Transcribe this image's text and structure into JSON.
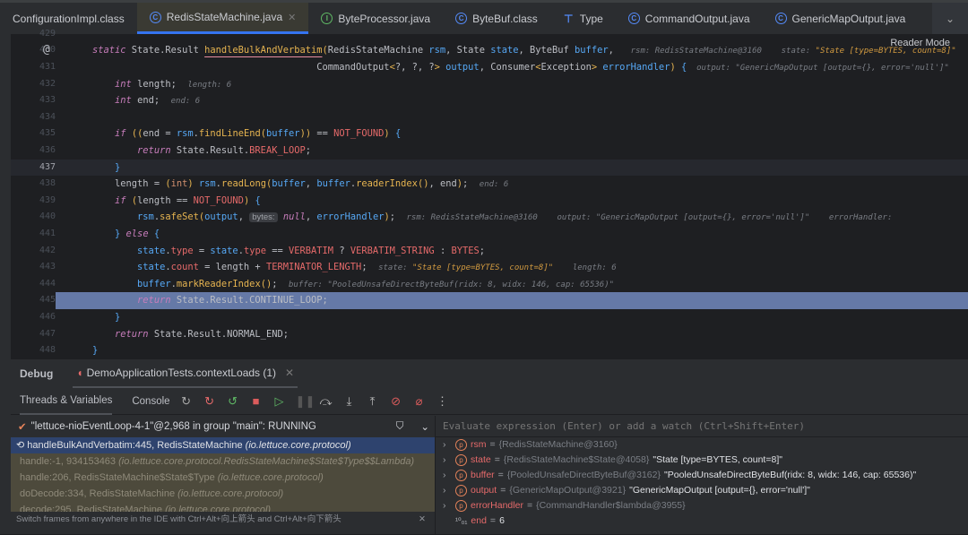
{
  "tabs": [
    {
      "label": "ConfigurationImpl.class",
      "icon": "none"
    },
    {
      "label": "RedisStateMachine.java",
      "icon": "class-icon",
      "active": true
    },
    {
      "label": "ByteProcessor.java",
      "icon": "interface-icon"
    },
    {
      "label": "ByteBuf.class",
      "icon": "class-icon"
    },
    {
      "label": "Type",
      "icon": "type-icon"
    },
    {
      "label": "CommandOutput.java",
      "icon": "class-icon"
    },
    {
      "label": "GenericMapOutput.java",
      "icon": "class-icon"
    }
  ],
  "editor": {
    "reader_mode": "Reader Mode",
    "current_line": 437,
    "execution_line": 445,
    "lines": [
      {
        "n": 429,
        "t": []
      },
      {
        "n": 430,
        "g": "@",
        "t": [
          [
            "static ",
            "kw"
          ],
          [
            "State.Result ",
            "pl"
          ],
          [
            "handleBulkAndVerbatim",
            "fnname"
          ],
          [
            "(",
            "gen"
          ],
          [
            "RedisStateMachine ",
            "pl"
          ],
          [
            "rsm",
            "var"
          ],
          [
            ", State ",
            "pl"
          ],
          [
            "state",
            "var"
          ],
          [
            ", ByteBuf ",
            "pl"
          ],
          [
            "buffer",
            "var"
          ],
          [
            ",   ",
            "pl"
          ],
          [
            "rsm: RedisStateMachine@3160    ",
            "hint"
          ],
          [
            "state: ",
            "hint"
          ],
          [
            "\"State [type=BYTES, count=8]\"",
            "hstr"
          ]
        ]
      },
      {
        "n": 431,
        "t": [
          [
            "                                        CommandOutput",
            "pl"
          ],
          [
            "<",
            "gen"
          ],
          [
            "?, ?, ?",
            "pl"
          ],
          [
            ">",
            "gen"
          ],
          [
            " ",
            "pl"
          ],
          [
            "output",
            "var"
          ],
          [
            ", Consumer",
            "pl"
          ],
          [
            "<",
            "gen"
          ],
          [
            "Exception",
            "pl"
          ],
          [
            ">",
            "gen"
          ],
          [
            " ",
            "pl"
          ],
          [
            "errorHandler",
            "var"
          ],
          [
            ") ",
            "gen"
          ],
          [
            "{",
            "brace"
          ],
          [
            "  output: \"GenericMapOutput [output={}, error='null']\"",
            "hint"
          ]
        ]
      },
      {
        "n": 432,
        "t": [
          [
            "    ",
            "pl"
          ],
          [
            "int ",
            "kw"
          ],
          [
            "length;  ",
            "pl"
          ],
          [
            "length: 6",
            "hint"
          ]
        ]
      },
      {
        "n": 433,
        "t": [
          [
            "    ",
            "pl"
          ],
          [
            "int ",
            "kw"
          ],
          [
            "end;  ",
            "pl"
          ],
          [
            "end: 6",
            "hint"
          ]
        ]
      },
      {
        "n": 434,
        "t": []
      },
      {
        "n": 435,
        "t": [
          [
            "    ",
            "pl"
          ],
          [
            "if ",
            "kw"
          ],
          [
            "((",
            "gen"
          ],
          [
            "end = ",
            "pl"
          ],
          [
            "rsm",
            "var"
          ],
          [
            ".",
            "pl"
          ],
          [
            "findLineEnd",
            "fn"
          ],
          [
            "(",
            "gen"
          ],
          [
            "buffer",
            "var"
          ],
          [
            "))",
            "gen"
          ],
          [
            " == ",
            "pl"
          ],
          [
            "NOT_FOUND",
            "const"
          ],
          [
            ") ",
            "gen"
          ],
          [
            "{",
            "brace"
          ]
        ]
      },
      {
        "n": 436,
        "t": [
          [
            "        ",
            "pl"
          ],
          [
            "return ",
            "kw"
          ],
          [
            "State.Result.",
            "pl"
          ],
          [
            "BREAK_LOOP",
            "const"
          ],
          [
            ";",
            "pl"
          ]
        ]
      },
      {
        "n": 437,
        "t": [
          [
            "    ",
            "pl"
          ],
          [
            "}",
            "brace"
          ]
        ]
      },
      {
        "n": 438,
        "t": [
          [
            "    length = ",
            "pl"
          ],
          [
            "(",
            "gen"
          ],
          [
            "int",
            "kwn"
          ],
          [
            ") ",
            "gen"
          ],
          [
            "rsm",
            "var"
          ],
          [
            ".",
            "pl"
          ],
          [
            "readLong",
            "fn"
          ],
          [
            "(",
            "gen"
          ],
          [
            "buffer",
            "var"
          ],
          [
            ", ",
            "pl"
          ],
          [
            "buffer",
            "var"
          ],
          [
            ".",
            "pl"
          ],
          [
            "readerIndex",
            "fn"
          ],
          [
            "()",
            "gen"
          ],
          [
            ", end",
            "pl"
          ],
          [
            ")",
            "gen"
          ],
          [
            ";  ",
            "pl"
          ],
          [
            "end: 6",
            "hint"
          ]
        ]
      },
      {
        "n": 439,
        "t": [
          [
            "    ",
            "pl"
          ],
          [
            "if ",
            "kw"
          ],
          [
            "(",
            "gen"
          ],
          [
            "length == ",
            "pl"
          ],
          [
            "NOT_FOUND",
            "const"
          ],
          [
            ") ",
            "gen"
          ],
          [
            "{",
            "brace"
          ]
        ]
      },
      {
        "n": 440,
        "t": [
          [
            "        ",
            "pl"
          ],
          [
            "rsm",
            "var"
          ],
          [
            ".",
            "pl"
          ],
          [
            "safeSet",
            "fn"
          ],
          [
            "(",
            "gen"
          ],
          [
            "output",
            "var"
          ],
          [
            ", ",
            "pl"
          ],
          [
            "bytes:",
            "inlay"
          ],
          [
            " ",
            "pl"
          ],
          [
            "null",
            "kw"
          ],
          [
            ", ",
            "pl"
          ],
          [
            "errorHandler",
            "var"
          ],
          [
            ")",
            "gen"
          ],
          [
            ";  ",
            "pl"
          ],
          [
            "rsm: RedisStateMachine@3160    output: \"GenericMapOutput [output={}, error='null']\"    errorHandler: ",
            "hint"
          ]
        ]
      },
      {
        "n": 441,
        "t": [
          [
            "    ",
            "pl"
          ],
          [
            "} ",
            "brace"
          ],
          [
            "else ",
            "kw"
          ],
          [
            "{",
            "brace"
          ]
        ]
      },
      {
        "n": 442,
        "t": [
          [
            "        ",
            "pl"
          ],
          [
            "state",
            "var"
          ],
          [
            ".",
            "pl"
          ],
          [
            "type",
            "fld"
          ],
          [
            " = ",
            "pl"
          ],
          [
            "state",
            "var"
          ],
          [
            ".",
            "pl"
          ],
          [
            "type",
            "fld"
          ],
          [
            " == ",
            "pl"
          ],
          [
            "VERBATIM",
            "const"
          ],
          [
            " ? ",
            "pl"
          ],
          [
            "VERBATIM_STRING",
            "const"
          ],
          [
            " : ",
            "pl"
          ],
          [
            "BYTES",
            "const"
          ],
          [
            ";",
            "pl"
          ]
        ]
      },
      {
        "n": 443,
        "t": [
          [
            "        ",
            "pl"
          ],
          [
            "state",
            "var"
          ],
          [
            ".",
            "pl"
          ],
          [
            "count",
            "fld"
          ],
          [
            " = length + ",
            "pl"
          ],
          [
            "TERMINATOR_LENGTH",
            "const"
          ],
          [
            ";  ",
            "pl"
          ],
          [
            "state: ",
            "hint"
          ],
          [
            "\"State [type=BYTES, count=8]\"",
            "hstr"
          ],
          [
            "    length: 6",
            "hint"
          ]
        ]
      },
      {
        "n": 444,
        "t": [
          [
            "        ",
            "pl"
          ],
          [
            "buffer",
            "var"
          ],
          [
            ".",
            "pl"
          ],
          [
            "markReaderIndex",
            "fn"
          ],
          [
            "()",
            "gen"
          ],
          [
            ";  ",
            "pl"
          ],
          [
            "buffer: \"PooledUnsafeDirectByteBuf(ridx: 8, widx: 146, cap: 65536)\"",
            "hint"
          ]
        ]
      },
      {
        "n": 445,
        "t": [
          [
            "        ",
            "pl"
          ],
          [
            "return ",
            "kw"
          ],
          [
            "State.Result.CONTINUE_LOOP;",
            "pl"
          ]
        ]
      },
      {
        "n": 446,
        "t": [
          [
            "    ",
            "pl"
          ],
          [
            "}",
            "brace"
          ]
        ]
      },
      {
        "n": 447,
        "t": [
          [
            "    ",
            "pl"
          ],
          [
            "return ",
            "kw"
          ],
          [
            "State.Result.NORMAL_END;",
            "pl"
          ]
        ]
      },
      {
        "n": 448,
        "t": [
          [
            "}",
            "brace"
          ]
        ]
      }
    ]
  },
  "debug": {
    "title": "Debug",
    "session": "DemoApplicationTests.contextLoads (1)",
    "subtabs": [
      "Threads & Variables",
      "Console"
    ],
    "thread": "\"lettuce-nioEventLoop-4-1\"@2,968 in group \"main\": RUNNING",
    "frames": [
      {
        "method": "handleBulkAndVerbatim:445, RedisStateMachine ",
        "pkg": "(io.lettuce.core.protocol)",
        "selected": true
      },
      {
        "method": "handle:-1, 934153463 ",
        "pkg": "(io.lettuce.core.protocol.RedisStateMachine$State$Type$$Lambda)"
      },
      {
        "method": "handle:206, RedisStateMachine$State$Type ",
        "pkg": "(io.lettuce.core.protocol)"
      },
      {
        "method": "doDecode:334, RedisStateMachine ",
        "pkg": "(io.lettuce.core.protocol)"
      },
      {
        "method": "decode:295, RedisStateMachine ",
        "pkg": "(io.lettuce.core.protocol)"
      }
    ],
    "hint": "Switch frames from anywhere in the IDE with Ctrl+Alt+向上箭头 and Ctrl+Alt+向下箭头",
    "eval_placeholder": "Evaluate expression (Enter) or add a watch (Ctrl+Shift+Enter)",
    "variables": [
      {
        "name": "rsm",
        "type": "{RedisStateMachine@3160}",
        "value": ""
      },
      {
        "name": "state",
        "type": "{RedisStateMachine$State@4058}",
        "value": "\"State [type=BYTES, count=8]\""
      },
      {
        "name": "buffer",
        "type": "{PooledUnsafeDirectByteBuf@3162}",
        "value": "\"PooledUnsafeDirectByteBuf(ridx: 8, widx: 146, cap: 65536)\""
      },
      {
        "name": "output",
        "type": "{GenericMapOutput@3921}",
        "value": "\"GenericMapOutput [output={}, error='null']\""
      },
      {
        "name": "errorHandler",
        "type": "{CommandHandler$lambda@3955}",
        "value": ""
      },
      {
        "name": "end",
        "type": "",
        "value": "6",
        "primitive": true
      }
    ]
  }
}
